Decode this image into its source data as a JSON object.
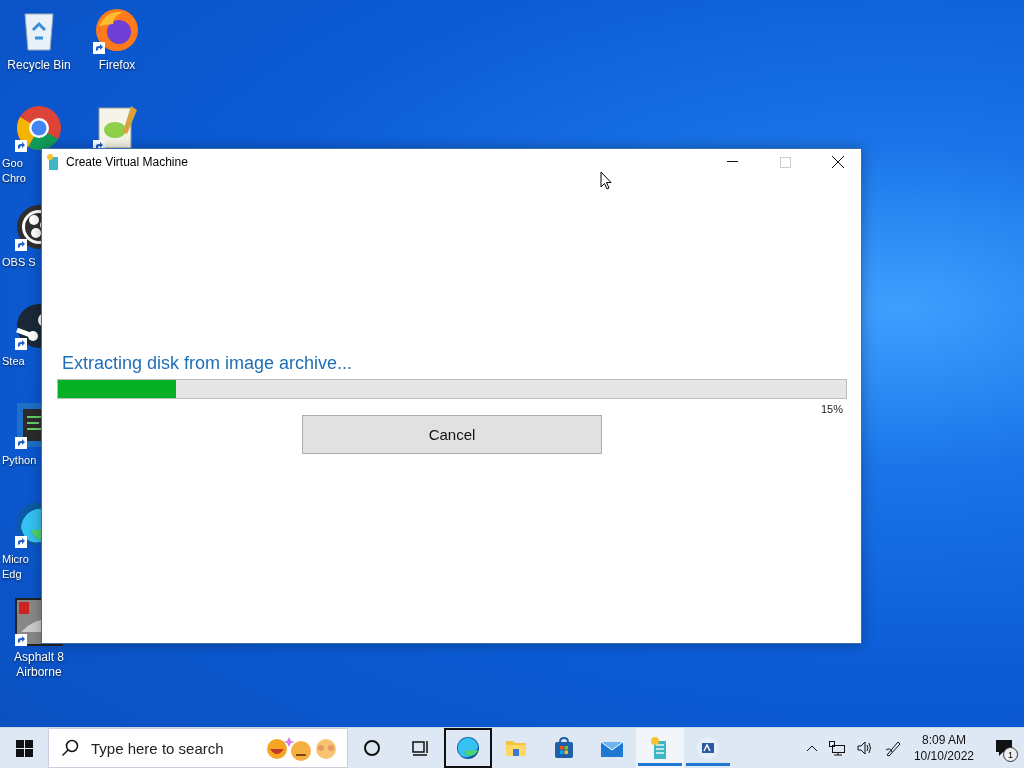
{
  "desktop_icons": [
    {
      "kind": "recycle",
      "label": "Recycle Bin",
      "clipped": false,
      "shortcut": false
    },
    {
      "kind": "firefox",
      "label": "Firefox",
      "clipped": false,
      "shortcut": true
    },
    {
      "kind": "chrome",
      "label": "Goo\nChro",
      "clipped": true,
      "shortcut": true
    },
    {
      "kind": "notepad",
      "shortcut": true
    },
    {
      "kind": "obs",
      "label": "OBS S",
      "clipped": true,
      "shortcut": true
    },
    {
      "kind": "steam",
      "label": "Stea",
      "clipped": true,
      "shortcut": true
    },
    {
      "kind": "python",
      "label": "Python",
      "clipped": true,
      "shortcut": true
    },
    {
      "kind": "edge",
      "label": "Micro\nEdg",
      "clipped": true,
      "shortcut": true
    },
    {
      "kind": "asphalt",
      "label": "Asphalt 8\nAirborne",
      "clipped": false,
      "shortcut": true
    }
  ],
  "window": {
    "title": "Create Virtual Machine",
    "status": "Extracting disk from image archive...",
    "progress": {
      "level": 0.15,
      "reading": "15%"
    },
    "buttons": [
      "Cancel"
    ]
  },
  "taskbar": {
    "search": {
      "placeholder": "Type here to search"
    },
    "apps": [
      {
        "kind": "cortana",
        "focused": false,
        "selected": false,
        "running": false
      },
      {
        "kind": "taskview",
        "focused": false,
        "selected": false,
        "running": false
      },
      {
        "kind": "edge",
        "focused": true,
        "selected": false,
        "running": false
      },
      {
        "kind": "explorer",
        "focused": false,
        "selected": false,
        "running": false
      },
      {
        "kind": "store",
        "focused": false,
        "selected": false,
        "running": false
      },
      {
        "kind": "mail",
        "focused": false,
        "selected": false,
        "running": false
      },
      {
        "kind": "vm",
        "focused": false,
        "selected": true,
        "running": true
      },
      {
        "kind": "writer",
        "focused": false,
        "selected": false,
        "running": true
      }
    ],
    "clock": {
      "time": "8:09 AM",
      "date": "10/10/2022"
    },
    "notifications": "1"
  }
}
